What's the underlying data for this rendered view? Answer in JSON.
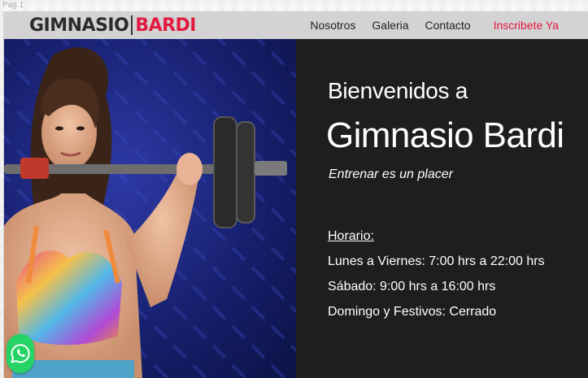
{
  "page_label": "Pag 1",
  "brand": {
    "part1": "GIMNASIO",
    "part2": "BARDI"
  },
  "nav": {
    "items": [
      "Nosotros",
      "Galeria",
      "Contacto"
    ],
    "cta": "Inscribete Ya"
  },
  "hero": {
    "welcome": "Bienvenidos a",
    "name": "Gimnasio Bardi",
    "tagline": "Entrenar es un placer"
  },
  "schedule": {
    "title": "Horario:",
    "lines": [
      "Lunes a Viernes: 7:00 hrs a 22:00 hrs",
      "Sábado: 9:00 hrs a 16:00 hrs",
      "Domingo y Festivos: Cerrado"
    ]
  },
  "icons": {
    "whatsapp": "whatsapp-icon"
  },
  "colors": {
    "accent": "#e3193f",
    "navbar": "#d3d3d3",
    "panel": "#1e1e1e",
    "whatsapp": "#25d366"
  }
}
